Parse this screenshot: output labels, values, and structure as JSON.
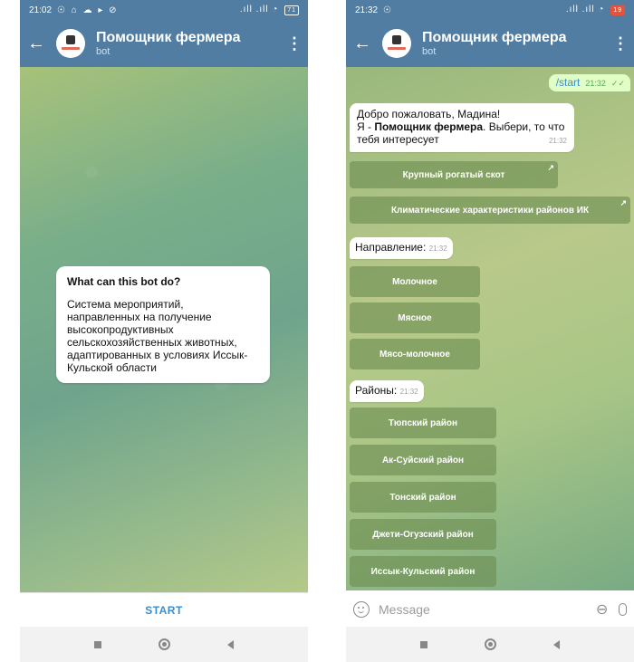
{
  "left": {
    "status": {
      "time": "21:02",
      "icons": "☉ ⌂ ☁ ▸ ⊘",
      "signal": ".ıll .ıll ◔",
      "battery": "71"
    },
    "header": {
      "title": "Помощник фермера",
      "subtitle": "bot"
    },
    "info_card": {
      "heading": "What can this bot do?",
      "body": "Система мероприятий, направленных на получение высокопродуктивных сельскохозяйственных животных, адаптированных в условиях Иссык-Кульской области"
    },
    "start_label": "START"
  },
  "right": {
    "status": {
      "time": "21:32",
      "icons": "☉",
      "signal": ".ıll .ıll ◔",
      "battery": "19"
    },
    "header": {
      "title": "Помощник фермера",
      "subtitle": "bot"
    },
    "outgoing": {
      "text": "/start",
      "time": "21:32"
    },
    "welcome": {
      "line1": "Добро пожаловать, Мадина!",
      "prefix": "Я - ",
      "bold": "Помощник фермера",
      "rest": ". Выбери, то что тебя  интересует",
      "time": "21:32"
    },
    "buttons1": [
      "Крупный рогатый скот",
      "Климатические характеристики районов ИК"
    ],
    "direction_msg": {
      "text": "Направление:",
      "time": "21:32"
    },
    "direction_buttons": [
      "Молочное",
      "Мясное",
      "Мясо-молочное"
    ],
    "regions_msg": {
      "text": "Районы:",
      "time": "21:32"
    },
    "region_buttons": [
      "Тюпский район",
      "Ак-Суйский район",
      "Тонский район",
      "Джети-Огузский район",
      "Иссык-Кульский район"
    ],
    "input_placeholder": "Message"
  }
}
